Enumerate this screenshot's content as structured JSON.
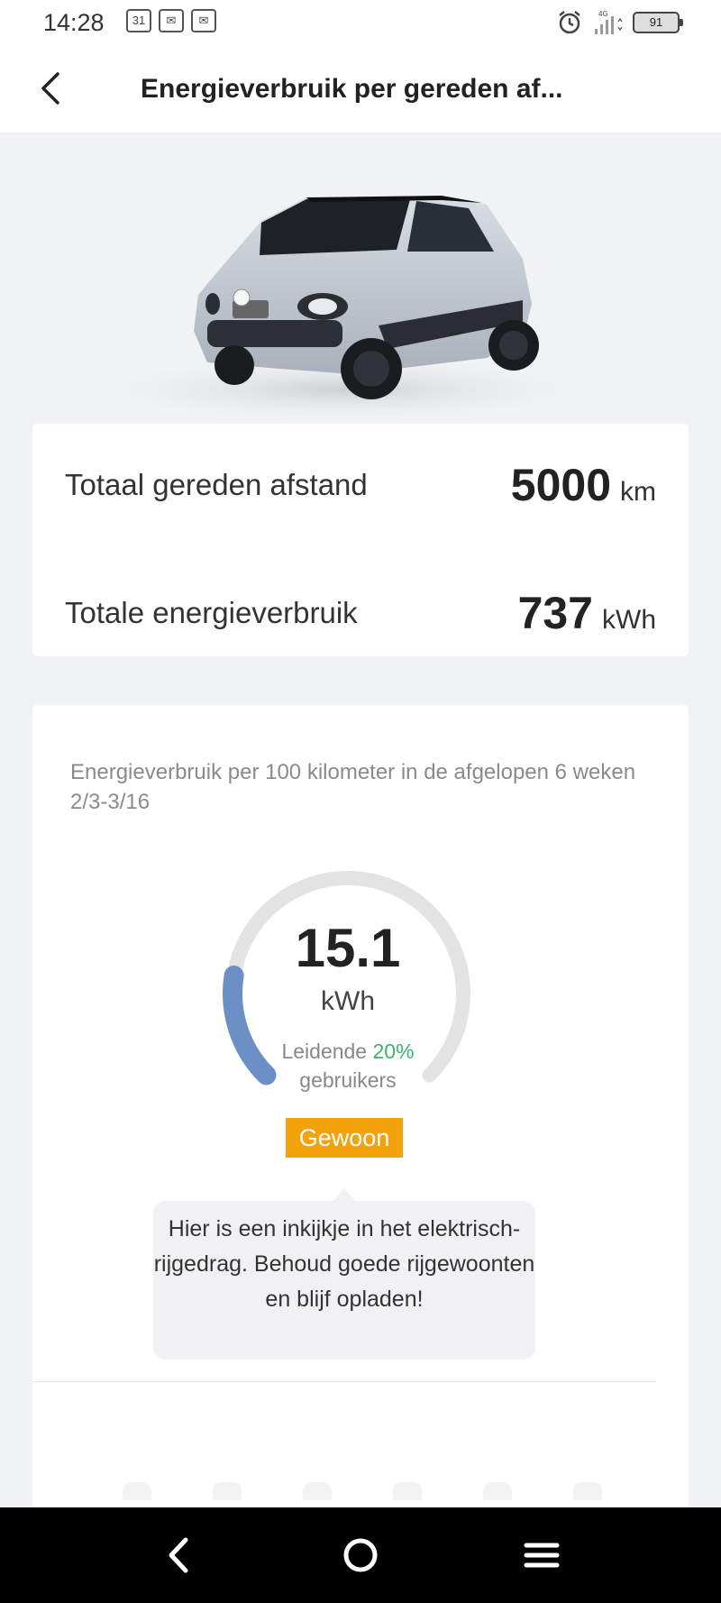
{
  "status_bar": {
    "time": "14:28",
    "calendar_day": "31",
    "battery_level": "91",
    "network": "4G"
  },
  "header": {
    "title": "Energieverbruik per gereden af..."
  },
  "stats": {
    "distance_label": "Totaal gereden afstand",
    "distance_value": "5000",
    "distance_unit": "km",
    "energy_label": "Totale energieverbruik",
    "energy_value": "737",
    "energy_unit": "kWh"
  },
  "gauge": {
    "caption": "Energieverbruik per 100 kilometer in de afgelopen 6 weken 2/3-3/16",
    "value": "15.1",
    "unit": "kWh",
    "rank_prefix": "Leidende",
    "rank_percent": "20%",
    "rank_suffix": "gebruikers",
    "badge": "Gewoon",
    "level_fraction": 0.2,
    "tip": "Hier is een inkijkje in het elektrisch-rijgedrag. Behoud goede rijgewoonten en blijf opladen!"
  },
  "colors": {
    "accent_arc": "#6c8fc6",
    "badge": "#f4a20a",
    "rank_green": "#3cb371"
  },
  "icons": {
    "back": "chevron-left-icon",
    "nav_back": "nav-back-icon",
    "nav_home": "nav-home-icon",
    "nav_menu": "nav-menu-icon"
  }
}
